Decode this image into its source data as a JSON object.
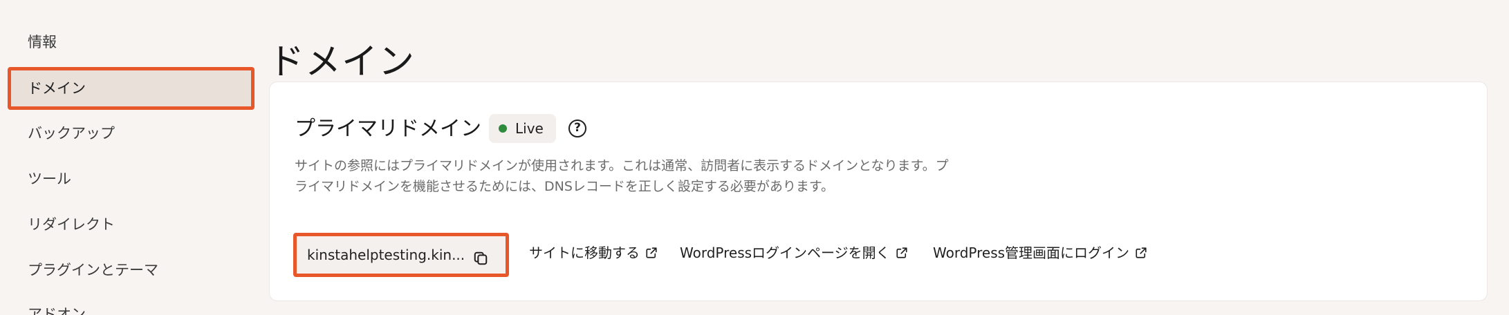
{
  "sidebar": {
    "items": [
      {
        "label": "情報"
      },
      {
        "label": "ドメイン"
      },
      {
        "label": "バックアップ"
      },
      {
        "label": "ツール"
      },
      {
        "label": "リダイレクト"
      },
      {
        "label": "プラグインとテーマ"
      },
      {
        "label": "アドオン"
      }
    ],
    "active_index": 1
  },
  "page": {
    "title": "ドメイン"
  },
  "primary_domain": {
    "title": "プライマリドメイン",
    "status": "Live",
    "status_color": "#2e8b3e",
    "help_icon": "question-circle-icon",
    "description": "サイトの参照にはプライマリドメインが使用されます。これは通常、訪問者に表示するドメインとなります。プライマリドメインを機能させるためには、DNSレコードを正しく設定する必要があります。",
    "domain_value": "kinstahelptesting.kin...",
    "copy_icon": "copy-icon",
    "links": [
      {
        "label": "サイトに移動する",
        "icon": "external-link-icon"
      },
      {
        "label": "WordPressログインページを開く",
        "icon": "external-link-icon"
      },
      {
        "label": "WordPress管理画面にログイン",
        "icon": "external-link-icon"
      }
    ]
  },
  "colors": {
    "highlight": "#e8572a",
    "background": "#f7f4f2",
    "active_bg": "#e9e0da"
  }
}
